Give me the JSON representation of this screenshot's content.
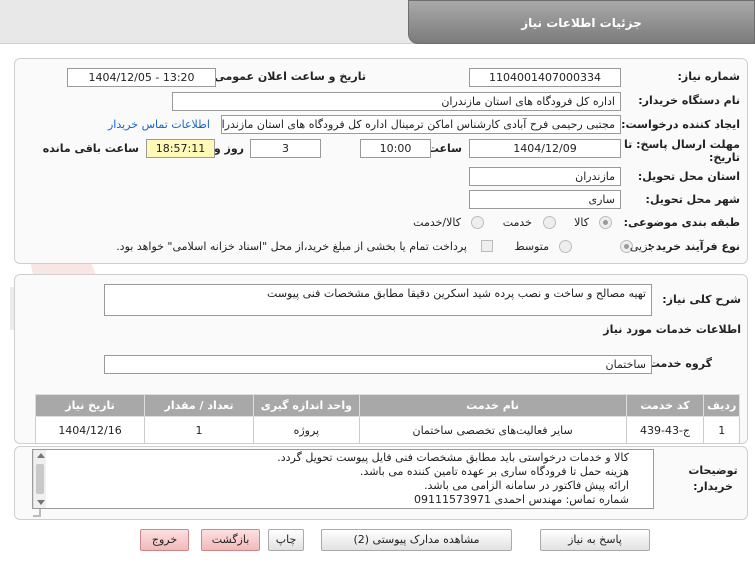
{
  "header": {
    "title": "جزئیات اطلاعات نیاز"
  },
  "form": {
    "need_number_label": "شماره نیاز:",
    "need_number": "1104001407000334",
    "announce_label": "تاریخ و ساعت اعلان عمومی:",
    "announce_value": "1404/12/05 - 13:20",
    "buyer_org_label": "نام دستگاه خریدار:",
    "buyer_org": "اداره کل فرودگاه های استان مازندران",
    "requester_label": "ایجاد کننده درخواست:",
    "requester": "مجتبی رحیمی فرح آبادی کارشناس اماکن ترمینال اداره کل فرودگاه های استان مازندران",
    "contact_link": "اطلاعات تماس خریدار",
    "deadline_label": "مهلت ارسال پاسخ: تا تاریخ:",
    "deadline_date": "1404/12/09",
    "time_label": "ساعت",
    "deadline_time": "10:00",
    "days": "3",
    "days_label": "روز و",
    "remaining_time": "18:57:11",
    "remaining_label": "ساعت باقی مانده",
    "province_label": "استان محل تحویل:",
    "province": "مازندران",
    "city_label": "شهر محل تحویل:",
    "city": "ساری",
    "category_label": "طبقه بندی موضوعی:",
    "category_options": [
      "کالا",
      "خدمت",
      "کالا/خدمت"
    ],
    "process_label": "نوع فرآیند خرید :",
    "process_options": [
      "جزیی",
      "متوسط"
    ],
    "payment_note": "پرداخت تمام یا بخشی از مبلغ خرید،از محل \"اسناد خزانه اسلامی\" خواهد بود."
  },
  "description": {
    "label": "شرح کلی نیاز:",
    "text": "تهیه مصالح و ساخت و نصب پرده شید اسکرین دقیقا مطابق مشخصات فنی پیوست"
  },
  "services": {
    "title": "اطلاعات خدمات مورد نیاز",
    "group_label": "گروه خدمت:",
    "group_value": "ساختمان",
    "columns": [
      "ردیف",
      "کد خدمت",
      "نام خدمت",
      "واحد اندازه گیری",
      "تعداد / مقدار",
      "تاریخ نیاز"
    ],
    "rows": [
      [
        "1",
        "ج-43-439",
        "سایر فعالیت‌های تخصصی ساختمان",
        "پروژه",
        "1",
        "1404/12/16"
      ]
    ]
  },
  "buyer_notes": {
    "label": "توضیحات خریدار:",
    "lines": [
      "کالا و خدمات درخواستی باید مطابق مشخصات فنی فایل پیوست تحویل گردد.",
      "هزینه حمل تا فرودگاه ساری بر عهده تامین کننده می باشد.",
      "ارائه پیش فاکتور در سامانه الزامی می باشد.",
      "شماره تماس: مهندس احمدی    09111573971"
    ]
  },
  "buttons": {
    "reply": "پاسخ به نیاز",
    "attachments": "مشاهده مدارک پیوستی (2)",
    "print": "چاپ",
    "back": "بازگشت",
    "exit": "خروج"
  },
  "watermark": "AriaTender.net",
  "colors": {
    "header": "#8f8f8f",
    "link": "#1b62c9",
    "highlight": "#fff9b7",
    "exit_button": "#f1b9b9"
  }
}
